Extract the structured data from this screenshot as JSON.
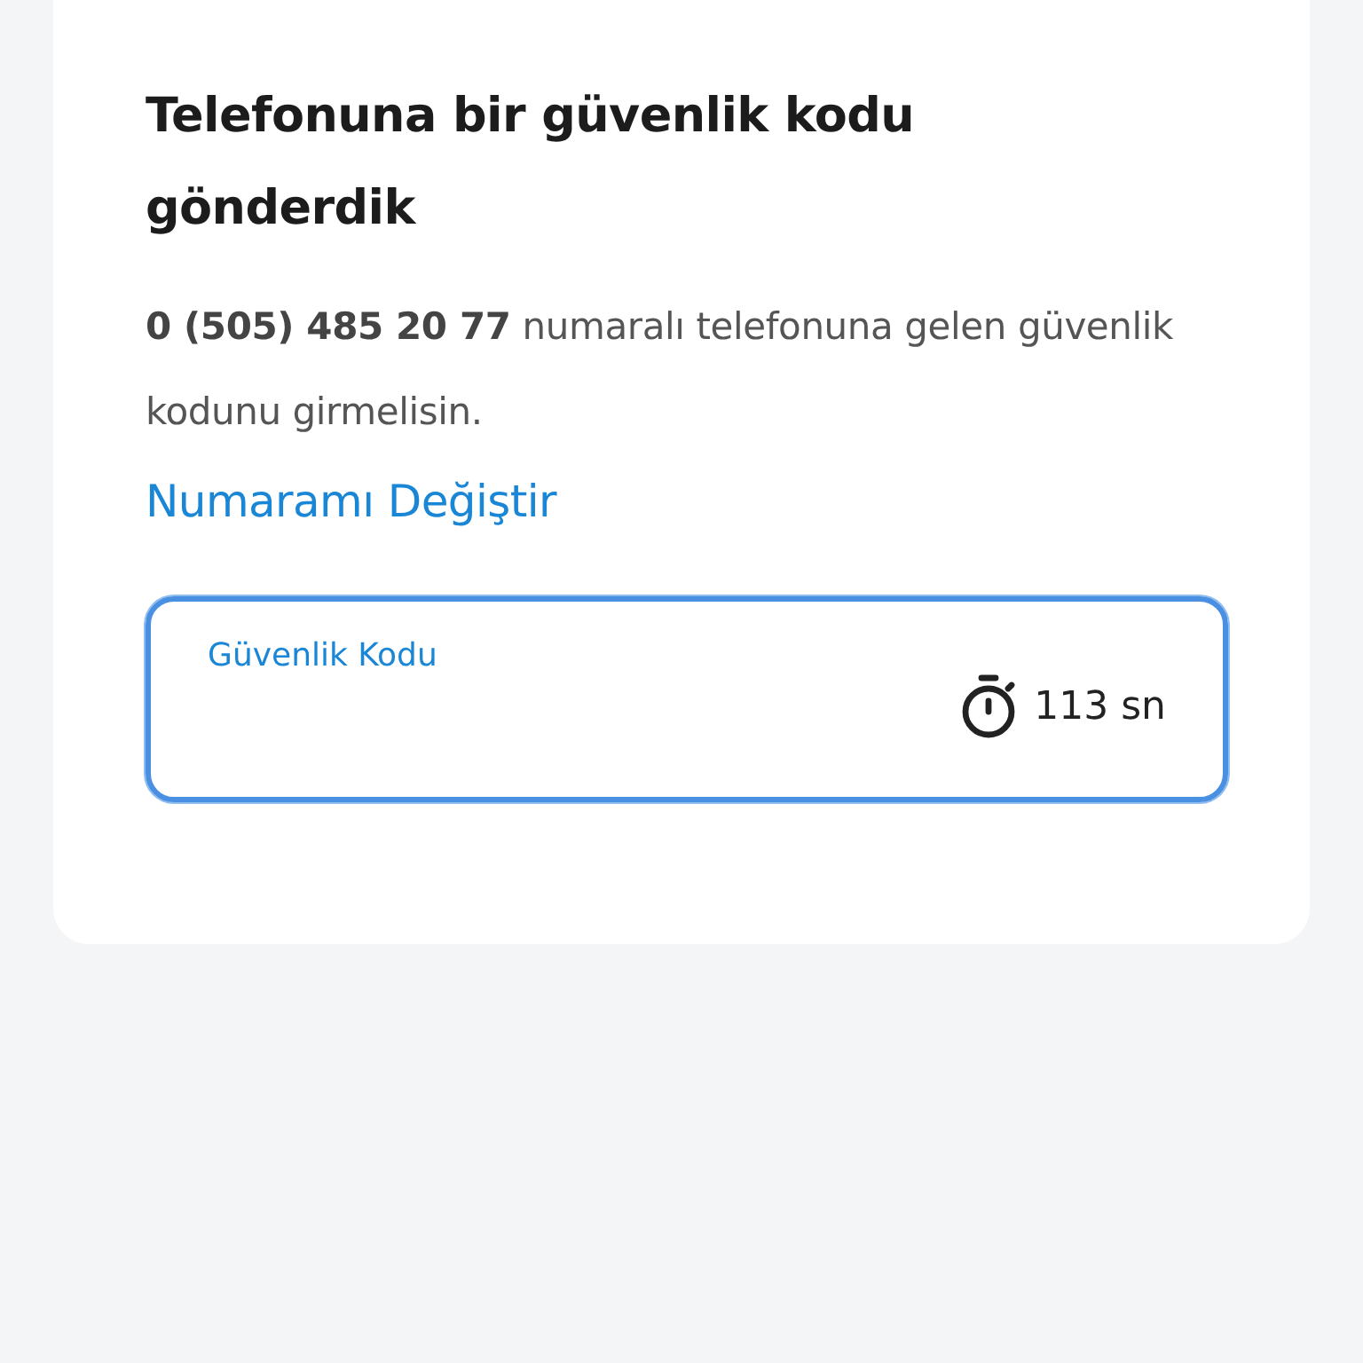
{
  "title": "Telefonuna bir güvenlik kodu gönderdik",
  "message": "**0 (505) 485 20 77** numaralı telefonuna gelen güvenlik kodunu girmelisin.",
  "change_number_link": "Numaramı Değiştir",
  "code_field": {
    "label": "Güvenlik Kodu",
    "focused": true,
    "timer": "113 sn"
  }
}
